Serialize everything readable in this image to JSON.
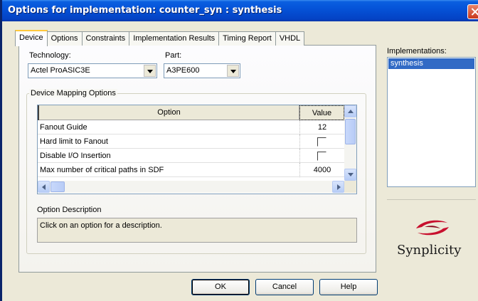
{
  "window": {
    "title": "Options for implementation: counter_syn : synthesis"
  },
  "tabs": [
    "Device",
    "Options",
    "Constraints",
    "Implementation Results",
    "Timing Report",
    "VHDL"
  ],
  "device": {
    "technology_label": "Technology:",
    "technology_value": "Actel ProASIC3E",
    "part_label": "Part:",
    "part_value": "A3PE600"
  },
  "mapping": {
    "title": "Device Mapping Options",
    "col_option": "Option",
    "col_value": "Value",
    "rows": [
      {
        "option": "Fanout Guide",
        "value": "12"
      },
      {
        "option": "Hard limit to Fanout",
        "value": ""
      },
      {
        "option": "Disable I/O Insertion",
        "value": ""
      },
      {
        "option": "Max number of critical paths in SDF",
        "value": "4000"
      }
    ],
    "desc_label": "Option Description",
    "desc_text": "Click on an option for a description."
  },
  "implementations": {
    "label": "Implementations:",
    "items": [
      "synthesis"
    ]
  },
  "logo": {
    "brand": "Synplicity"
  },
  "buttons": {
    "ok": "OK",
    "cancel": "Cancel",
    "help": "Help"
  },
  "colors": {
    "title_bar": "#0553d8",
    "selection": "#316ac5",
    "logo_red": "#c8102e"
  }
}
